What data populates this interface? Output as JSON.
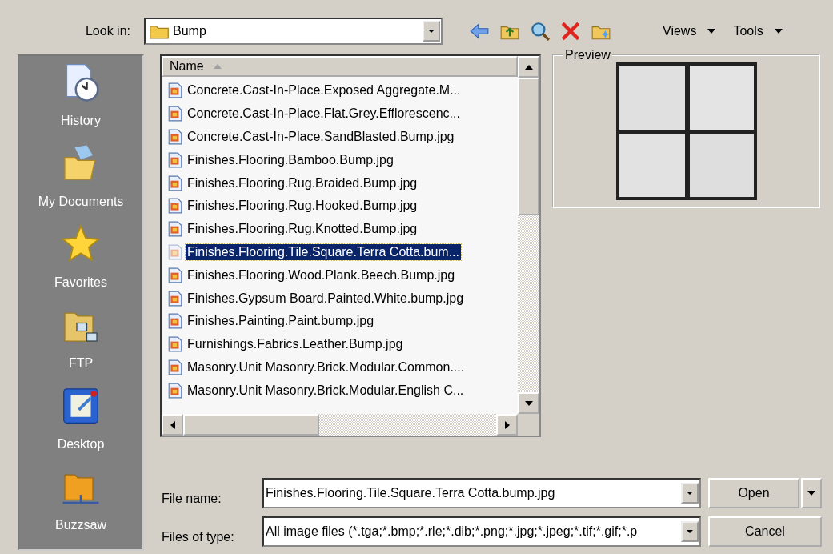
{
  "look_in": {
    "label": "Look in:",
    "value": "Bump"
  },
  "toolbar": {
    "views": "Views",
    "tools": "Tools"
  },
  "places": [
    {
      "label": "History",
      "kind": "history"
    },
    {
      "label": "My Documents",
      "kind": "documents"
    },
    {
      "label": "Favorites",
      "kind": "favorites"
    },
    {
      "label": "FTP",
      "kind": "ftp"
    },
    {
      "label": "Desktop",
      "kind": "desktop"
    },
    {
      "label": "Buzzsaw",
      "kind": "buzzsaw"
    }
  ],
  "file_list": {
    "column": "Name",
    "files": [
      {
        "name": "Concrete.Cast-In-Place.Exposed Aggregate.M...",
        "selected": false
      },
      {
        "name": "Concrete.Cast-In-Place.Flat.Grey.Efflorescenc...",
        "selected": false
      },
      {
        "name": "Concrete.Cast-In-Place.SandBlasted.Bump.jpg",
        "selected": false
      },
      {
        "name": "Finishes.Flooring.Bamboo.Bump.jpg",
        "selected": false
      },
      {
        "name": "Finishes.Flooring.Rug.Braided.Bump.jpg",
        "selected": false
      },
      {
        "name": "Finishes.Flooring.Rug.Hooked.Bump.jpg",
        "selected": false
      },
      {
        "name": "Finishes.Flooring.Rug.Knotted.Bump.jpg",
        "selected": false
      },
      {
        "name": "Finishes.Flooring.Tile.Square.Terra Cotta.bum...",
        "selected": true
      },
      {
        "name": "Finishes.Flooring.Wood.Plank.Beech.Bump.jpg",
        "selected": false
      },
      {
        "name": "Finishes.Gypsum Board.Painted.White.bump.jpg",
        "selected": false
      },
      {
        "name": "Finishes.Painting.Paint.bump.jpg",
        "selected": false
      },
      {
        "name": "Furnishings.Fabrics.Leather.Bump.jpg",
        "selected": false
      },
      {
        "name": "Masonry.Unit Masonry.Brick.Modular.Common....",
        "selected": false
      },
      {
        "name": "Masonry.Unit Masonry.Brick.Modular.English C...",
        "selected": false
      }
    ]
  },
  "preview": {
    "legend": "Preview"
  },
  "file_name": {
    "label": "File name:",
    "value": "Finishes.Flooring.Tile.Square.Terra Cotta.bump.jpg"
  },
  "file_type": {
    "label": "Files of type:",
    "value": "All image files (*.tga;*.bmp;*.rle;*.dib;*.png;*.jpg;*.jpeg;*.tif;*.gif;*.p"
  },
  "buttons": {
    "open": "Open",
    "cancel": "Cancel"
  }
}
